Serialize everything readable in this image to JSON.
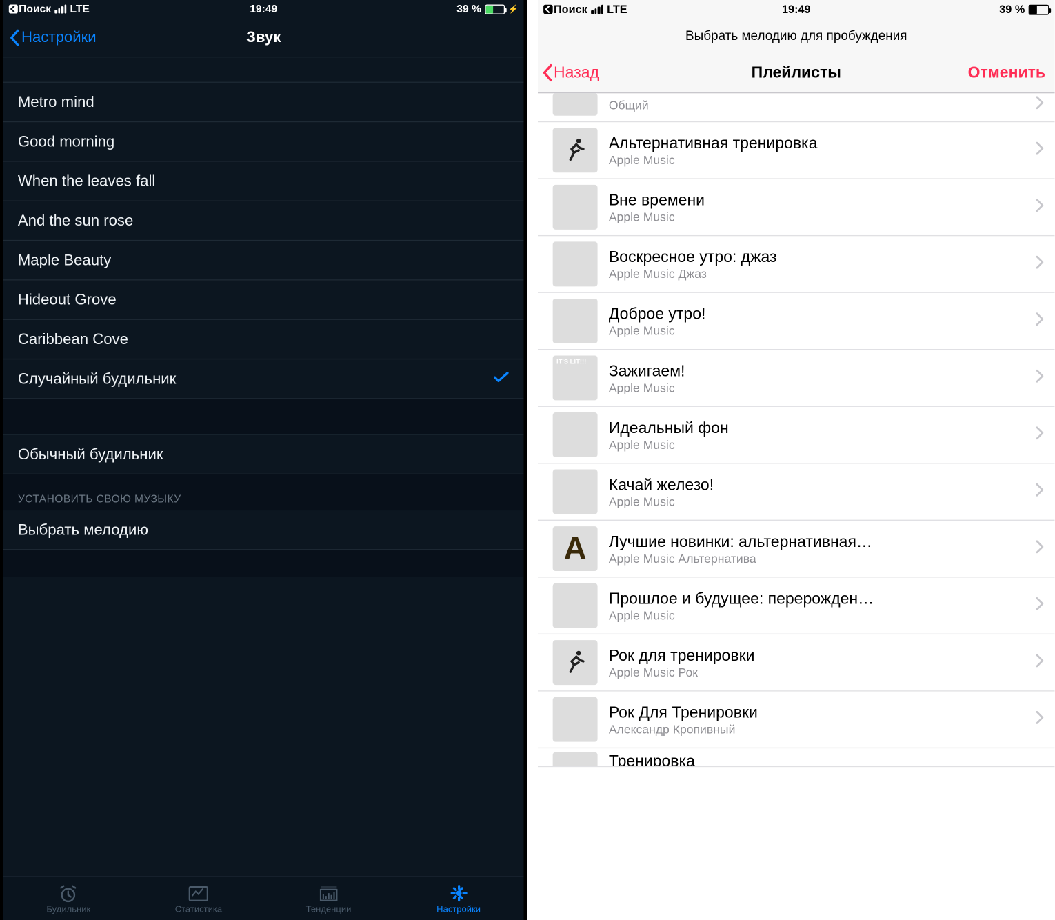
{
  "status": {
    "breadcrumb": "Поиск",
    "carrier": "LTE",
    "time": "19:49",
    "battery_pct": "39 %"
  },
  "left": {
    "nav_back": "Настройки",
    "nav_title": "Звук",
    "sounds": [
      "Metro mind",
      "Good morning",
      "When the leaves fall",
      "And the sun rose",
      "Maple Beauty",
      "Hideout Grove",
      "Caribbean Cove",
      "Случайный будильник"
    ],
    "selected_index": 7,
    "standard_row": "Обычный будильник",
    "section_header": "УСТАНОВИТЬ СВОЮ МУЗЫКУ",
    "pick_row": "Выбрать мелодию",
    "tabs": {
      "alarm": "Будильник",
      "stats": "Статистика",
      "trends": "Тенденции",
      "settings": "Настройки"
    }
  },
  "right": {
    "modal_title": "Выбрать мелодию для пробуждения",
    "nav_back": "Назад",
    "nav_title": "Плейлисты",
    "nav_cancel": "Отменить",
    "playlists": [
      {
        "title": "",
        "sub": "Общий",
        "art": "art-grey",
        "partial": true
      },
      {
        "title": "Альтернативная тренировка",
        "sub": "Apple Music",
        "art": "art-orange"
      },
      {
        "title": "Вне времени",
        "sub": "Apple Music",
        "art": "art-collage1"
      },
      {
        "title": "Воскресное утро: джаз",
        "sub": "Apple Music Джаз",
        "art": "art-jazz"
      },
      {
        "title": "Доброе утро!",
        "sub": "Apple Music",
        "art": "art-tiles"
      },
      {
        "title": "Зажигаем!",
        "sub": "Apple Music",
        "art": "art-lit"
      },
      {
        "title": "Идеальный фон",
        "sub": "Apple Music",
        "art": "art-circles"
      },
      {
        "title": "Качай железо!",
        "sub": "Apple Music",
        "art": "art-iron"
      },
      {
        "title": "Лучшие новинки: альтернативная…",
        "sub": "Apple Music Альтернатива",
        "art": "art-a"
      },
      {
        "title": "Прошлое и будущее: перерожден…",
        "sub": "Apple Music",
        "art": "art-past"
      },
      {
        "title": "Рок для тренировки",
        "sub": "Apple Music Рок",
        "art": "art-run"
      },
      {
        "title": "Рок Для Тренировки",
        "sub": "Александр Кропивный",
        "art": "art-grey"
      },
      {
        "title": "Тренировка",
        "sub": "",
        "art": "art-grey",
        "cut": true
      }
    ]
  }
}
